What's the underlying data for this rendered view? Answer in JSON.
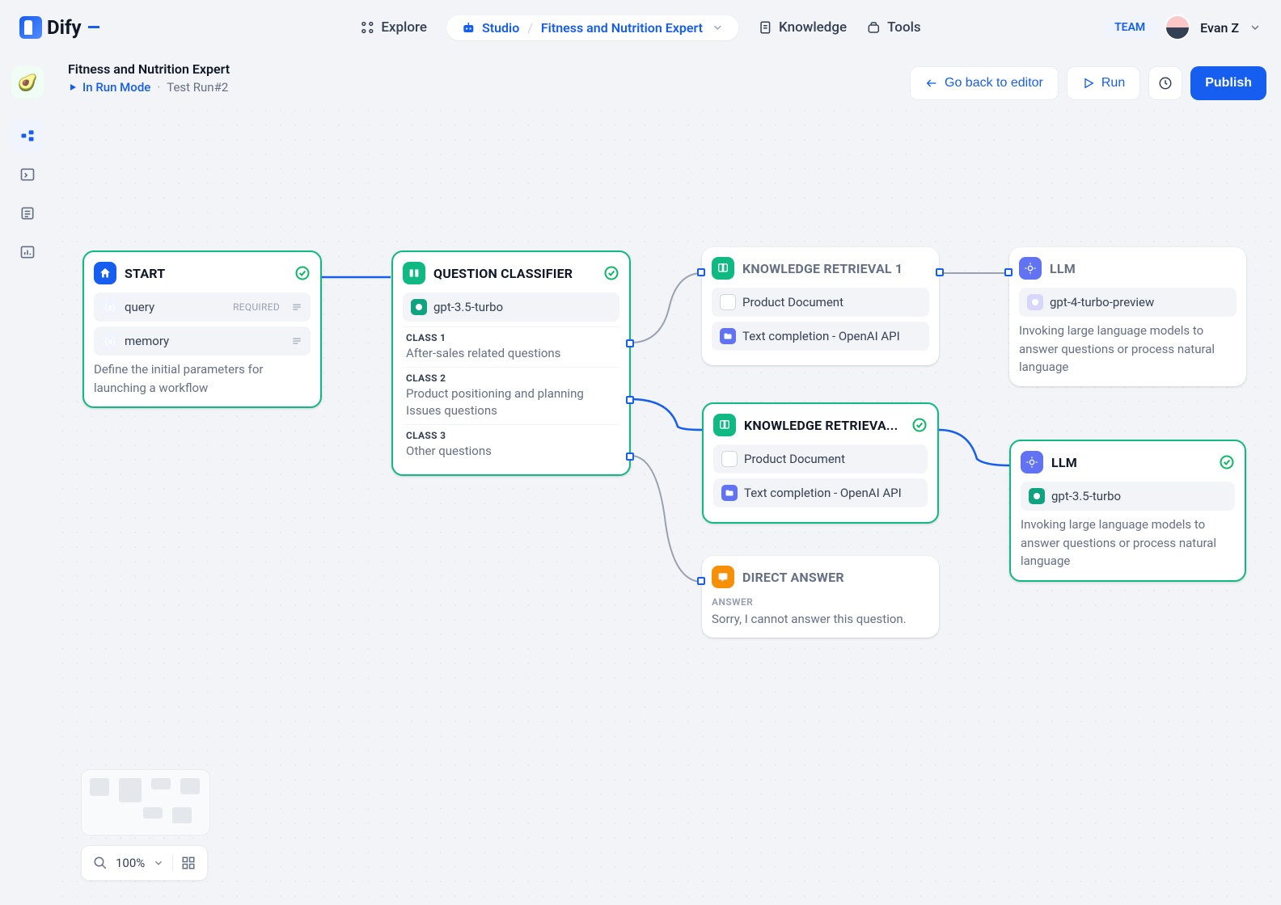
{
  "brand": "Dify",
  "nav": {
    "explore": "Explore",
    "studio": "Studio",
    "breadcrumb": "Fitness and Nutrition Expert",
    "knowledge": "Knowledge",
    "tools": "Tools"
  },
  "user": {
    "team_badge": "TEAM",
    "name": "Evan Z"
  },
  "subheader": {
    "app_title": "Fitness and Nutrition Expert",
    "run_mode": "In Run Mode",
    "test_run": "Test Run#2"
  },
  "actions": {
    "back": "Go back to editor",
    "run": "Run",
    "publish": "Publish"
  },
  "zoom": "100%",
  "nodes": {
    "start": {
      "title": "START",
      "var1": "query",
      "var1_req": "REQUIRED",
      "var2": "memory",
      "desc": "Define the initial parameters for launching a workflow"
    },
    "qc": {
      "title": "QUESTION CLASSIFIER",
      "model": "gpt-3.5-turbo",
      "c1_label": "CLASS 1",
      "c1_text": "After-sales related questions",
      "c2_label": "CLASS 2",
      "c2_text": "Product positioning and planning Issues questions",
      "c3_label": "CLASS 3",
      "c3_text": "Other questions"
    },
    "kr1": {
      "title": "KNOWLEDGE RETRIEVAL 1",
      "doc": "Product Document",
      "api": "Text completion - OpenAI API"
    },
    "kr2": {
      "title": "KNOWLEDGE RETRIEVA...",
      "doc": "Product Document",
      "api": "Text completion - OpenAI API"
    },
    "llm1": {
      "title": "LLM",
      "model": "gpt-4-turbo-preview",
      "desc": "Invoking large language models to answer questions or process natural language"
    },
    "llm2": {
      "title": "LLM",
      "model": "gpt-3.5-turbo",
      "desc": "Invoking large language models to answer questions or process natural language"
    },
    "da": {
      "title": "DIRECT ANSWER",
      "ans_label": "ANSWER",
      "ans_text": "Sorry, I cannot answer this question."
    }
  }
}
